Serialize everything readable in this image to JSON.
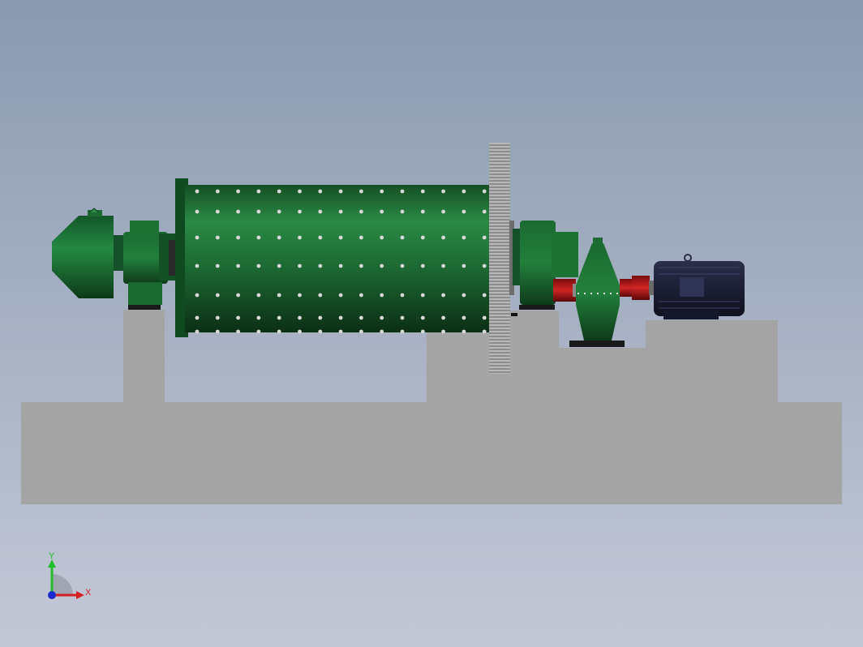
{
  "viewport": {
    "background_top": "#8a9ab0",
    "background_bottom": "#c3c8d6"
  },
  "model": {
    "parts": [
      "foundation",
      "feed-end-cover",
      "feed-end-bearing",
      "mill-shell",
      "girth-gear",
      "discharge-end-bearing",
      "pinion-coupling",
      "gear-reducer",
      "motor-coupling",
      "electric-motor"
    ],
    "colors": {
      "shell": "#1f6b34",
      "foundation": "#a3a3a3",
      "gear": "#9a9a9a",
      "coupling": "#b01818",
      "motor": "#20233a"
    }
  },
  "triad": {
    "y_label": "Y",
    "x_label": "X",
    "y_color": "#1fbf2a",
    "x_color": "#d42020",
    "z_color": "#1a2ad0"
  }
}
